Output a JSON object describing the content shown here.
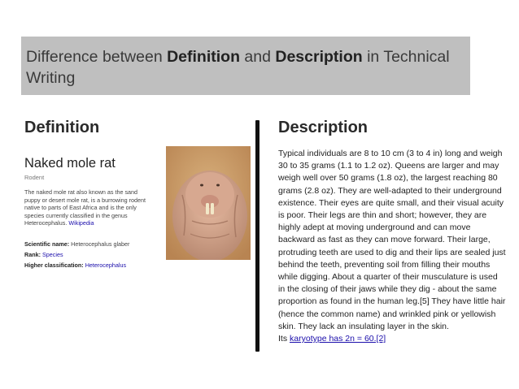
{
  "slide": {
    "title_pre": "Difference between ",
    "title_b1": "Definition",
    "title_mid": " and ",
    "title_b2": "Description",
    "title_post": " in Technical Writing",
    "left_heading": "Definition",
    "right_heading": "Description"
  },
  "card": {
    "name": "Naked mole rat",
    "subtitle": "Rodent",
    "desc": "The naked mole rat also known as the sand puppy or desert mole rat, is a burrowing rodent native to parts of East Africa and is the only species currently classified in the genus Heterocephalus.",
    "desc_link": "Wikipedia",
    "sci_label": "Scientific name:",
    "sci_value": "Heterocephalus glaber",
    "rank_label": "Rank:",
    "rank_value": "Species",
    "higher_label": "Higher classification:",
    "higher_value": "Heterocephalus"
  },
  "description": {
    "text": "Typical individuals are 8 to 10 cm (3 to 4 in) long and weigh 30 to 35 grams (1.1 to 1.2 oz). Queens are larger and may weigh well over 50 grams (1.8 oz), the largest reaching 80 grams (2.8 oz). They are well-adapted to their underground existence. Their eyes are quite small, and their visual acuity is poor. Their legs are thin and short; however, they are highly adept at moving underground and can move backward as fast as they can move forward. Their large, protruding teeth are used to dig and their lips are sealed just behind the teeth, preventing soil from filling their mouths while digging. About a quarter of their musculature is used in the closing of their jaws while they dig - about the same proportion as found in the human leg.[5] They have little hair (hence the common name) and wrinkled pink or yellowish skin. They lack an insulating layer in the skin.",
    "last_pre": "Its ",
    "last_link": "karyotype has 2n = 60.[2]"
  }
}
